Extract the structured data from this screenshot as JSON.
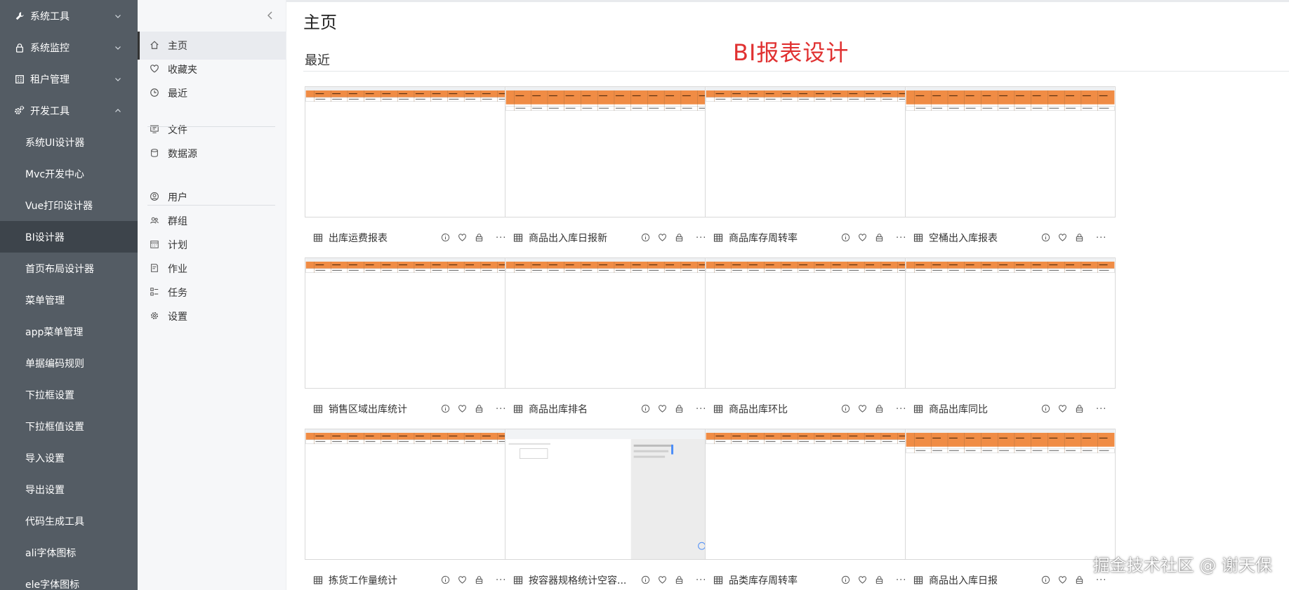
{
  "sidebar": {
    "items": [
      {
        "label": "系统工具",
        "type": "parent",
        "icon": "wrench-icon",
        "expanded": false
      },
      {
        "label": "系统监控",
        "type": "parent",
        "icon": "lock-icon",
        "expanded": false
      },
      {
        "label": "租户管理",
        "type": "parent",
        "icon": "building-icon",
        "expanded": false
      },
      {
        "label": "开发工具",
        "type": "parent",
        "icon": "gears-icon",
        "expanded": true
      },
      {
        "label": "系统UI设计器",
        "type": "child"
      },
      {
        "label": "Mvc开发中心",
        "type": "child"
      },
      {
        "label": "Vue打印设计器",
        "type": "child"
      },
      {
        "label": "BI设计器",
        "type": "child",
        "active": true
      },
      {
        "label": "首页布局设计器",
        "type": "child"
      },
      {
        "label": "菜单管理",
        "type": "child"
      },
      {
        "label": "app菜单管理",
        "type": "child"
      },
      {
        "label": "单据编码规则",
        "type": "child"
      },
      {
        "label": "下拉框设置",
        "type": "child"
      },
      {
        "label": "下拉框值设置",
        "type": "child"
      },
      {
        "label": "导入设置",
        "type": "child"
      },
      {
        "label": "导出设置",
        "type": "child"
      },
      {
        "label": "代码生成工具",
        "type": "child"
      },
      {
        "label": "ali字体图标",
        "type": "child"
      },
      {
        "label": "ele字体图标",
        "type": "child"
      }
    ]
  },
  "nav": {
    "items": [
      {
        "label": "主页",
        "icon": "home-icon",
        "active": true
      },
      {
        "label": "收藏夹",
        "icon": "heart-icon"
      },
      {
        "label": "最近",
        "icon": "clock-icon"
      },
      {
        "label": "文件",
        "icon": "file-icon"
      },
      {
        "label": "数据源",
        "icon": "database-icon"
      },
      {
        "label": "用户",
        "icon": "user-icon"
      },
      {
        "label": "群组",
        "icon": "group-icon"
      },
      {
        "label": "计划",
        "icon": "calendar-icon"
      },
      {
        "label": "作业",
        "icon": "job-icon"
      },
      {
        "label": "任务",
        "icon": "task-icon"
      },
      {
        "label": "设置",
        "icon": "gear-icon"
      }
    ]
  },
  "main": {
    "page_title": "主页",
    "banner": "BI报表设计",
    "section_label": "最近",
    "more_label": "···",
    "cards": [
      {
        "title": "出库运费报表"
      },
      {
        "title": "商品出入库日报新"
      },
      {
        "title": "商品库存周转率"
      },
      {
        "title": "空桶出入库报表"
      },
      {
        "title": "销售区域出库统计"
      },
      {
        "title": "商品出库排名"
      },
      {
        "title": "商品出库环比"
      },
      {
        "title": "商品出库同比"
      },
      {
        "title": "拣货工作量统计"
      },
      {
        "title": "按容器规格统计空容..."
      },
      {
        "title": "品类库存周转率"
      },
      {
        "title": "商品出入库日报"
      }
    ]
  },
  "watermark": "掘金技术社区 @ 谢天保",
  "colors": {
    "sidebar_bg": "#545c64",
    "sidebar_active": "#3d444b",
    "header_orange": "#f08c45",
    "banner_red": "#e03131"
  }
}
